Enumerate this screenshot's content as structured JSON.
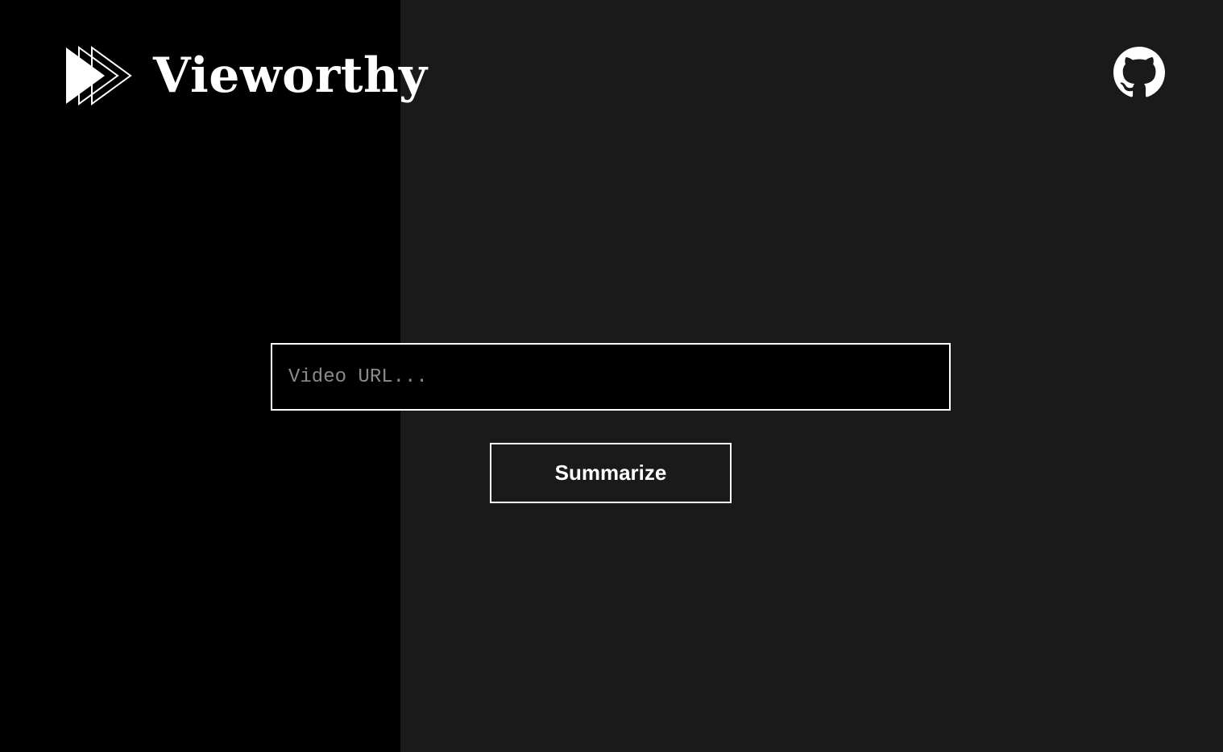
{
  "header": {
    "logo_icon": "fast-forward-icon",
    "brand_name": "Vieworthy",
    "github_icon": "github-icon"
  },
  "search": {
    "value": "",
    "placeholder": "Video URL..."
  },
  "actions": {
    "summarize_label": "Summarize"
  },
  "colors": {
    "left_panel": "#000000",
    "background": "#1a1a1a",
    "foreground": "#ffffff",
    "placeholder": "#8a8a8a"
  }
}
